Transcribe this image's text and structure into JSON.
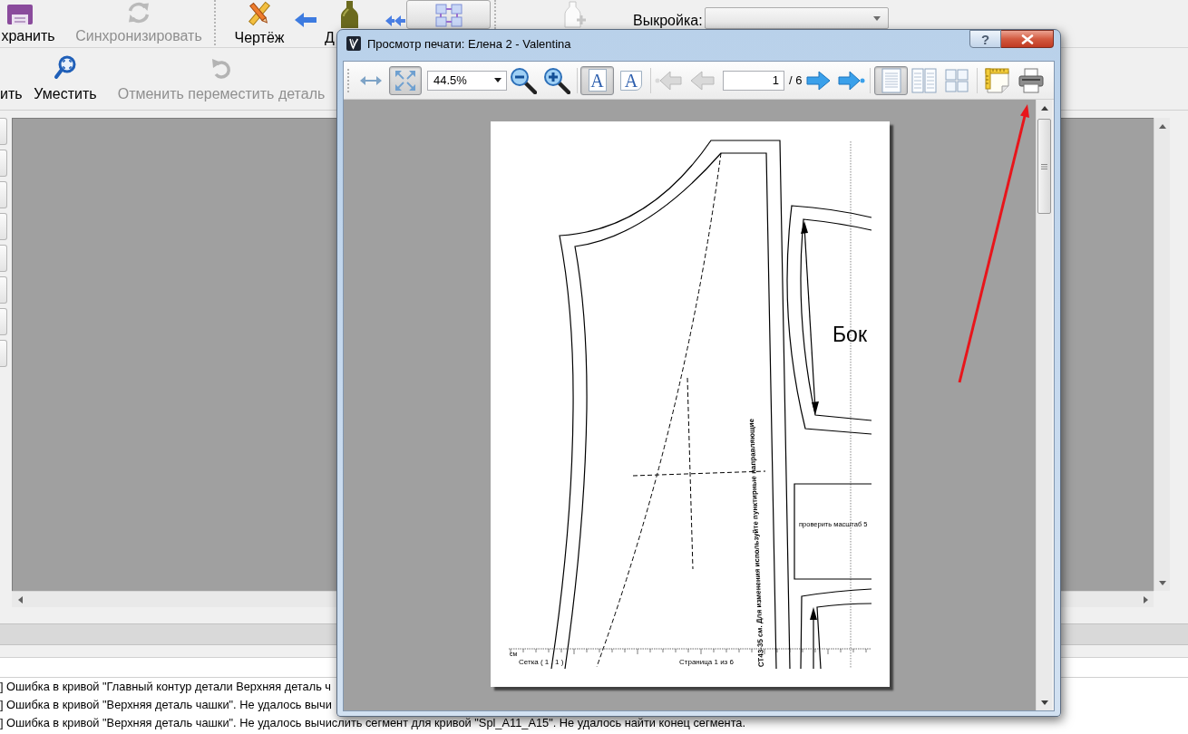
{
  "main_window": {
    "toolbar": [
      [
        {
          "kind": "save",
          "label": "хранить",
          "selected": false,
          "disabled": false
        },
        {
          "kind": "sync",
          "label": "Синхронизировать",
          "selected": false,
          "disabled": true
        }
      ],
      [
        {
          "kind": "draw",
          "label": "Чертёж",
          "selected": false,
          "disabled": false
        },
        {
          "kind": "back",
          "selected": false,
          "disabled": false
        },
        {
          "kind": "piece",
          "label": "Д",
          "selected": false,
          "disabled": false
        },
        {
          "kind": "back_all",
          "selected": false,
          "disabled": false
        },
        {
          "kind": "layout",
          "selected": true,
          "disabled": false
        }
      ],
      [
        {
          "kind": "add_piece",
          "selected": false,
          "disabled": true
        }
      ]
    ],
    "pattern_selector": {
      "label": "Выкройка:"
    },
    "toolbar_2": [
      {
        "kind": "zoom",
        "label": "ить",
        "disabled": false
      },
      {
        "kind": "fit",
        "label": "Уместить",
        "disabled": false
      },
      {
        "kind": "undo",
        "label": "Отменить переместить деталь",
        "disabled": true
      }
    ],
    "log": [
      "] Ошибка в кривой \"Главный контур детали Верхняя деталь ч",
      "] Ошибка в кривой \"Верхняя деталь чашки\". Не удалось вычи",
      "] Ошибка в кривой \"Верхняя деталь чашки\". Не удалось вычислить сегмент для кривой \"Spl_A11_A15\". Не удалось найти конец сегмента."
    ]
  },
  "print_preview": {
    "title": "Просмотр печати: Елена 2 - Valentina",
    "help_button": "?",
    "toolbar": [
      [
        {
          "kind": "fit_width",
          "selected": false,
          "disabled": false
        },
        {
          "kind": "fit_page",
          "selected": true,
          "disabled": false
        },
        {
          "kind": "zoom_field",
          "value": "44.5%",
          "selected": false,
          "disabled": false
        },
        {
          "kind": "zoom_out",
          "selected": false,
          "disabled": false
        },
        {
          "kind": "zoom_in",
          "selected": false,
          "disabled": false
        }
      ],
      [
        {
          "kind": "portrait",
          "glyph": "A",
          "selected": true,
          "disabled": false
        },
        {
          "kind": "landscape",
          "glyph": "A",
          "selected": false,
          "disabled": false
        }
      ],
      [
        {
          "kind": "first_page",
          "selected": false,
          "disabled": true
        },
        {
          "kind": "prev_page",
          "selected": false,
          "disabled": true
        },
        {
          "kind": "page_field",
          "value": "1",
          "selected": false,
          "disabled": false
        },
        {
          "kind": "page_total",
          "label": "/ 6",
          "selected": false,
          "disabled": false
        },
        {
          "kind": "next_page",
          "selected": false,
          "disabled": false
        },
        {
          "kind": "last_page",
          "selected": false,
          "disabled": false
        }
      ],
      [
        {
          "kind": "single_page",
          "selected": true,
          "disabled": false
        },
        {
          "kind": "facing_pages",
          "selected": false,
          "disabled": false
        },
        {
          "kind": "all_pages",
          "selected": false,
          "disabled": false
        }
      ],
      [
        {
          "kind": "page_setup",
          "selected": false,
          "disabled": false
        },
        {
          "kind": "print",
          "selected": false,
          "disabled": false
        }
      ]
    ],
    "page": {
      "piece_label": "Бок",
      "scale_note": "проверить масштаб 5",
      "vertical_note": "СТ43-35 см. Для изменения используйте пунктирные направляющие",
      "ruler_unit": "см",
      "grid_label": "Сетка ( 1 , 1 )",
      "page_label": "Страница 1 из 6"
    }
  },
  "annotation": {
    "kind": "arrow"
  }
}
